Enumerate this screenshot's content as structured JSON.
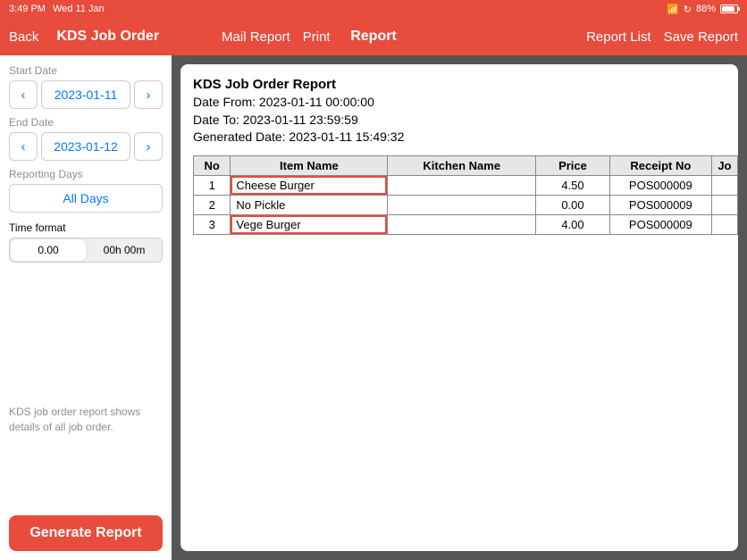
{
  "statusbar": {
    "time": "3:49 PM",
    "date": "Wed 11 Jan",
    "battery": "88%"
  },
  "nav": {
    "back": "Back",
    "title": "KDS Job Order",
    "mail": "Mail Report",
    "print": "Print",
    "center": "Report",
    "list": "Report List",
    "save": "Save Report"
  },
  "sidebar": {
    "start_label": "Start Date",
    "start_value": "2023-01-11",
    "end_label": "End Date",
    "end_value": "2023-01-12",
    "days_label": "Reporting Days",
    "all_days": "All Days",
    "tf_label": "Time format",
    "tf_opt1": "0.00",
    "tf_opt2": "00h 00m",
    "help": "KDS job order report shows details of all job order.",
    "generate": "Generate Report"
  },
  "report": {
    "title": "KDS Job Order Report",
    "from_label": "Date From: ",
    "from_value": "2023-01-11 00:00:00",
    "to_label": "Date To: ",
    "to_value": "2023-01-11 23:59:59",
    "gen_label": "Generated Date: ",
    "gen_value": "2023-01-11 15:49:32",
    "cols": {
      "no": "No",
      "item": "Item Name",
      "kitchen": "Kitchen Name",
      "price": "Price",
      "receipt": "Receipt No",
      "partial": "Jo"
    },
    "rows": [
      {
        "no": "1",
        "item": "Cheese Burger",
        "kitchen": "",
        "price": "4.50",
        "receipt": "POS000009",
        "hl": true
      },
      {
        "no": "2",
        "item": "No Pickle",
        "kitchen": "",
        "price": "0.00",
        "receipt": "POS000009",
        "hl": false
      },
      {
        "no": "3",
        "item": "Vege Burger",
        "kitchen": "",
        "price": "4.00",
        "receipt": "POS000009",
        "hl": true
      }
    ]
  }
}
